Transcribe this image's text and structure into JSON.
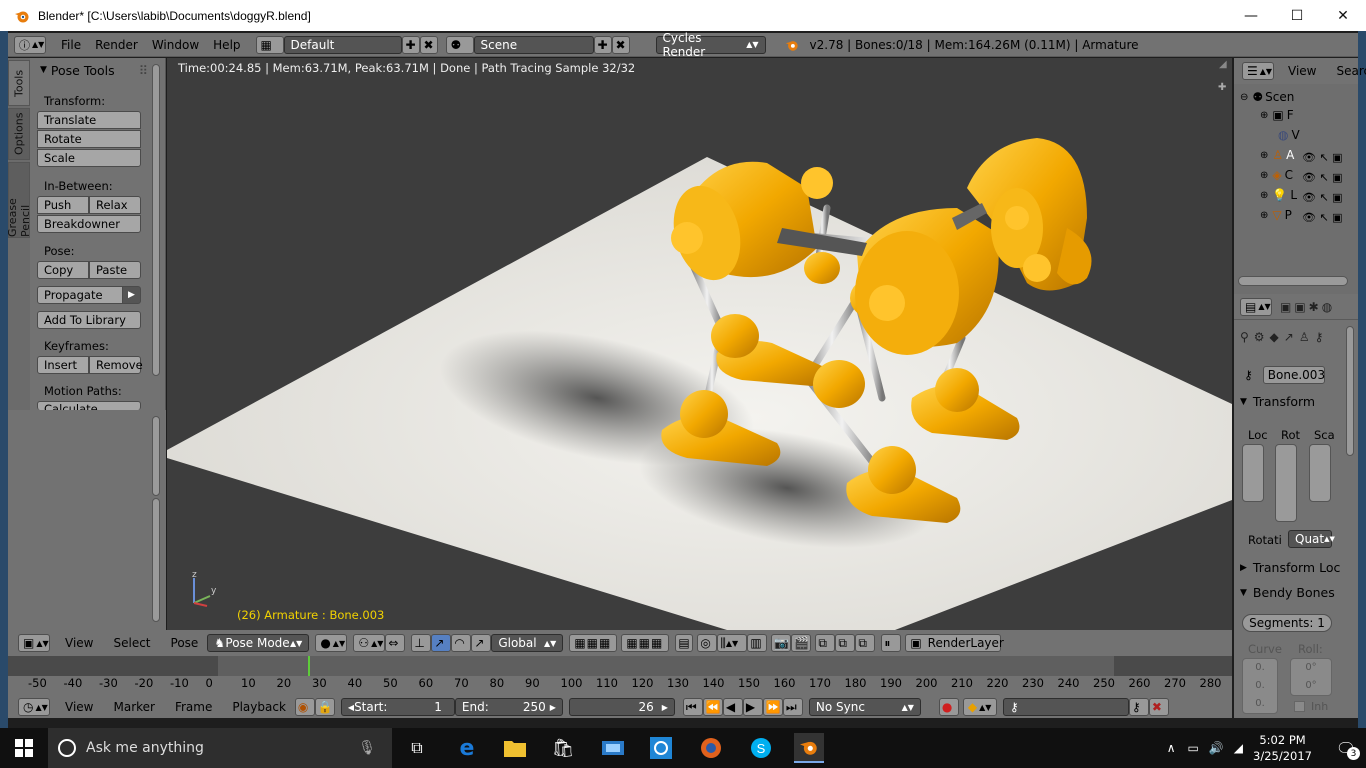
{
  "titlebar": {
    "title": "Blender* [C:\\Users\\labib\\Documents\\doggyR.blend]",
    "minimize_glyph": "—",
    "maximize_glyph": "☐",
    "close_glyph": "✕"
  },
  "infobar": {
    "menus": [
      "File",
      "Render",
      "Window",
      "Help"
    ],
    "layout_name": "Default",
    "scene_name": "Scene",
    "engine": "Cycles Render",
    "stats": "v2.78 | Bones:0/18  | Mem:164.26M (0.11M) | Armature"
  },
  "tabs": [
    "Tools",
    "Options",
    "Grease Pencil"
  ],
  "tool_shelf": {
    "panel_title": "Pose Tools",
    "transform_label": "Transform:",
    "translate": "Translate",
    "rotate": "Rotate",
    "scale": "Scale",
    "inbetween_label": "In-Between:",
    "push": "Push",
    "relax": "Relax",
    "breakdowner": "Breakdowner",
    "pose_label": "Pose:",
    "copy": "Copy",
    "paste": "Paste",
    "propagate": "Propagate",
    "add_to_library": "Add To Library",
    "keyframes_label": "Keyframes:",
    "insert": "Insert",
    "remove": "Remove",
    "motion_paths_label": "Motion Paths:",
    "calculate": "Calculate"
  },
  "viewport": {
    "render_info": "Time:00:24.85 | Mem:63.71M, Peak:63.71M | Done | Path Tracing Sample 32/32",
    "object_info": "(26) Armature : Bone.003",
    "axis_z": "z",
    "axis_y": "y"
  },
  "v3d_header": {
    "menus": [
      "View",
      "Select",
      "Pose"
    ],
    "mode": "Pose Mode",
    "orientation": "Global",
    "render_layer": "RenderLayer"
  },
  "timeline": {
    "ticks": [
      "-50",
      "-40",
      "-30",
      "-20",
      "-10",
      "0",
      "10",
      "20",
      "30",
      "40",
      "50",
      "60",
      "70",
      "80",
      "90",
      "100",
      "110",
      "120",
      "130",
      "140",
      "150",
      "160",
      "170",
      "180",
      "190",
      "200",
      "210",
      "220",
      "230",
      "240",
      "250",
      "260",
      "270",
      "280"
    ],
    "menus": [
      "View",
      "Marker",
      "Frame",
      "Playback"
    ],
    "start_label": "Start:",
    "start_value": "1",
    "end_label": "End:",
    "end_value": "250",
    "current_frame": "26",
    "sync": "No Sync"
  },
  "outliner": {
    "menu_view": "View",
    "menu_search": "Searc",
    "scene_label": "Scen",
    "row1_label": "F",
    "row2_label": "V",
    "row3_label": "A",
    "row4_label": "C",
    "row5_label": "L",
    "row6_label": "P"
  },
  "properties": {
    "bone_name": "Bone.003",
    "transform_title": "Transform",
    "col_loc": "Loc",
    "col_rot": "Rot",
    "col_scale": "Sca",
    "rotation_label": "Rotati",
    "rotation_mode": "Quat",
    "transform_locks": "Transform Loc",
    "bendy_bones": "Bendy Bones",
    "segments": "Segments: 1",
    "curve_label": "Curve",
    "roll_label": "Roll:",
    "curve_val1": "0.",
    "curve_val2": "0.",
    "curve_val3": "0.",
    "roll_val1": "0°",
    "roll_val2": "0°",
    "inherit": "Inh"
  },
  "taskbar": {
    "search_placeholder": "Ask me anything",
    "time": "5:02 PM",
    "date": "3/25/2017",
    "notif_count": "3"
  },
  "colors": {
    "blender_orange": "#e87d0d",
    "panel_gray": "#727272",
    "viewport_bg": "#3d3d3d",
    "yellow_text": "#f2d200",
    "toy_yellow": "#f0a800"
  }
}
